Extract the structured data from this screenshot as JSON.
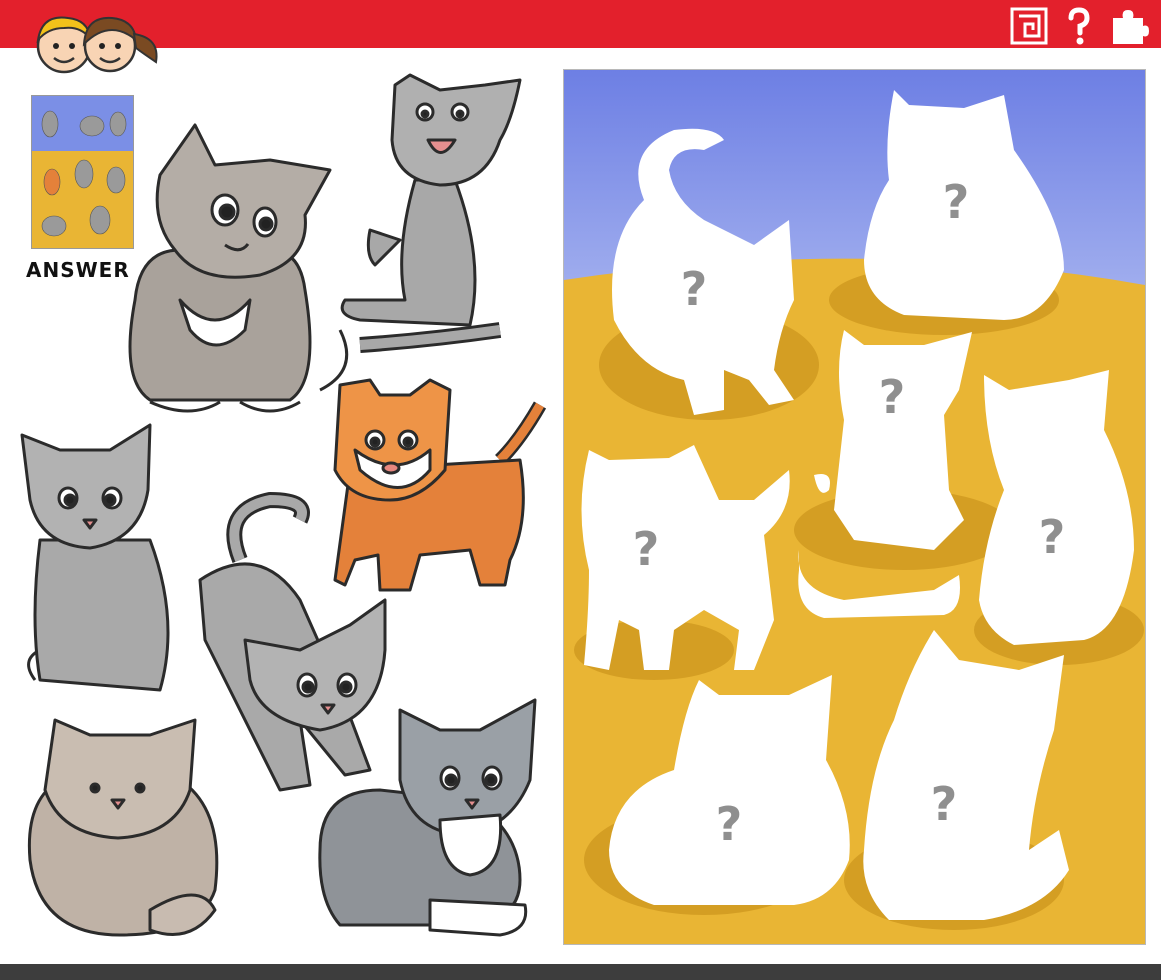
{
  "header": {
    "maze_icon": "maze-icon",
    "question_icon": "question-mark-icon",
    "puzzle_icon": "puzzle-piece-icon"
  },
  "answer_label": "ANSWER",
  "shadow_marks": [
    "?",
    "?",
    "?",
    "?",
    "?",
    "?",
    "?",
    "?"
  ],
  "colors": {
    "header_red": "#e3202c",
    "footer_gray": "#3d3d3d",
    "sky_blue": "#7b8fe6",
    "floor_yellow": "#e9b534",
    "shadow_white": "#ffffff",
    "question_gray": "#8f8f8f"
  }
}
